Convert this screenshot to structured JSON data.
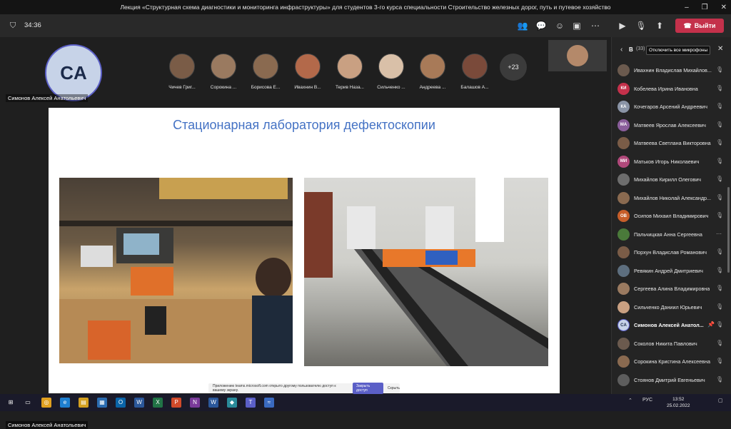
{
  "window": {
    "title": "Лекция «Структурная схема диагностики и мониторинга инфраструктуры» для студентов 3-го курса специальности Строительство железных дорог, путь и путевое хозяйство",
    "controls": [
      "–",
      "❐",
      "✕"
    ]
  },
  "meeting": {
    "timer": "34:36",
    "leave_label": "Выйти"
  },
  "presenter": {
    "initials": "CA",
    "name": "Симонов Алексей Анатольевич"
  },
  "strip": {
    "participants": [
      {
        "name": "Чичев Григ..."
      },
      {
        "name": "Сорокина ..."
      },
      {
        "name": "Борисова Е..."
      },
      {
        "name": "Ивахнин В..."
      },
      {
        "name": "Терив Наза..."
      },
      {
        "name": "Сильченко ..."
      },
      {
        "name": "Андреева ..."
      },
      {
        "name": "Балашов А..."
      }
    ],
    "more": "+23"
  },
  "slide": {
    "title": "Стационарная лаборатория дефектоскопии"
  },
  "notification": {
    "text": "Приложению teams.microsoft.com открыто другому пользователю доступ к вашему экрану.",
    "stop_label": "Закрыть доступ",
    "hide_label": "Скрыть"
  },
  "panel": {
    "label": "В",
    "count": "(33)",
    "mute_all_label": "Отключить все микрофоны",
    "items": [
      {
        "initials": "",
        "name": "Ивахнин Владислав Михайлов...",
        "color": "#6b5a4e"
      },
      {
        "initials": "КИ",
        "name": "Кобелева Ирина Ивановна",
        "color": "#c4314b"
      },
      {
        "initials": "КА",
        "name": "Кочегаров Арсений Андреевич",
        "color": "#8a94a6"
      },
      {
        "initials": "МА",
        "name": "Матвеев Ярослав Алексеевич",
        "color": "#8a5e9b"
      },
      {
        "initials": "",
        "name": "Матвеева Светлана Викторовна",
        "color": "#7a5c47"
      },
      {
        "initials": "МИ",
        "name": "Матьков Игорь Николаевич",
        "color": "#b0487a"
      },
      {
        "initials": "",
        "name": "Михайлов Кирилл Олегович",
        "color": "#6d6d6d"
      },
      {
        "initials": "",
        "name": "Михайлов Николай Александр...",
        "color": "#8a6a50"
      },
      {
        "initials": "ОВ",
        "name": "Осипов Михаил Владимирович",
        "color": "#c75e2a"
      },
      {
        "initials": "",
        "name": "Пальчицкая Анна Сергеевна",
        "color": "#4a7a3a"
      },
      {
        "initials": "",
        "name": "Порхун Владислав Романович",
        "color": "#7a5c47"
      },
      {
        "initials": "",
        "name": "Ревякин Андрей Дмитриевич",
        "color": "#5d6e7e"
      },
      {
        "initials": "",
        "name": "Сергеева Алина Владимировна",
        "color": "#9a7a60"
      },
      {
        "initials": "",
        "name": "Сильченко Даниил Юрьевич",
        "color": "#c9a082"
      },
      {
        "initials": "CA",
        "name": "Симонов Алексей Анатол...",
        "color": "#c7d3e8",
        "self": true
      },
      {
        "initials": "",
        "name": "Соколов Никита Павлович",
        "color": "#6b5a4e"
      },
      {
        "initials": "",
        "name": "Сорокина Кристина Алексеевна",
        "color": "#8a6a50"
      },
      {
        "initials": "",
        "name": "Стоянов Дмитрий Евгеньевич",
        "color": "#5d5d5d"
      }
    ]
  },
  "taskbar": {
    "lang": "РУС",
    "time": "13:52",
    "date": "25.02.2022"
  },
  "colors": {
    "accent": "#5b5fc7",
    "leave": "#c4314b",
    "slide_title": "#4472c4"
  }
}
